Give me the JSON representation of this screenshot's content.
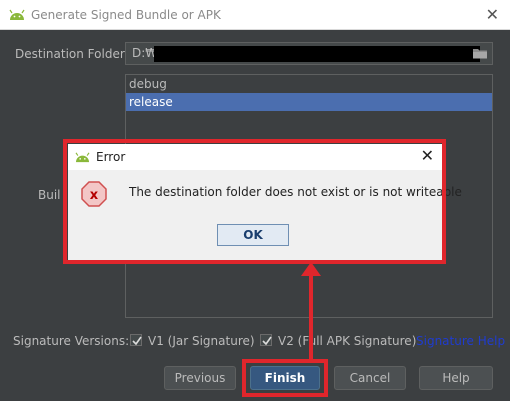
{
  "window": {
    "title": "Generate Signed Bundle or APK",
    "close": "✕"
  },
  "destination": {
    "label": "Destination Folder:",
    "value": "D:₩"
  },
  "build_variants": {
    "label_partial": "Buil",
    "items": [
      "debug",
      "release"
    ],
    "selected": "release"
  },
  "signature": {
    "label": "Signature Versions:",
    "v1": {
      "label": "V1 (Jar Signature)",
      "checked": true
    },
    "v2": {
      "label": "V2 (Full APK Signature)",
      "checked": true
    },
    "help": "Signature Help"
  },
  "buttons": {
    "previous": "Previous",
    "finish": "Finish",
    "cancel": "Cancel",
    "help": "Help"
  },
  "error_dialog": {
    "title": "Error",
    "close": "✕",
    "message": "The destination folder does not exist or is not writeable",
    "ok": "OK",
    "icon_letter": "x"
  },
  "colors": {
    "highlight": "#e0262c",
    "selection": "#4b6eaf",
    "link": "#1f3ccf"
  }
}
